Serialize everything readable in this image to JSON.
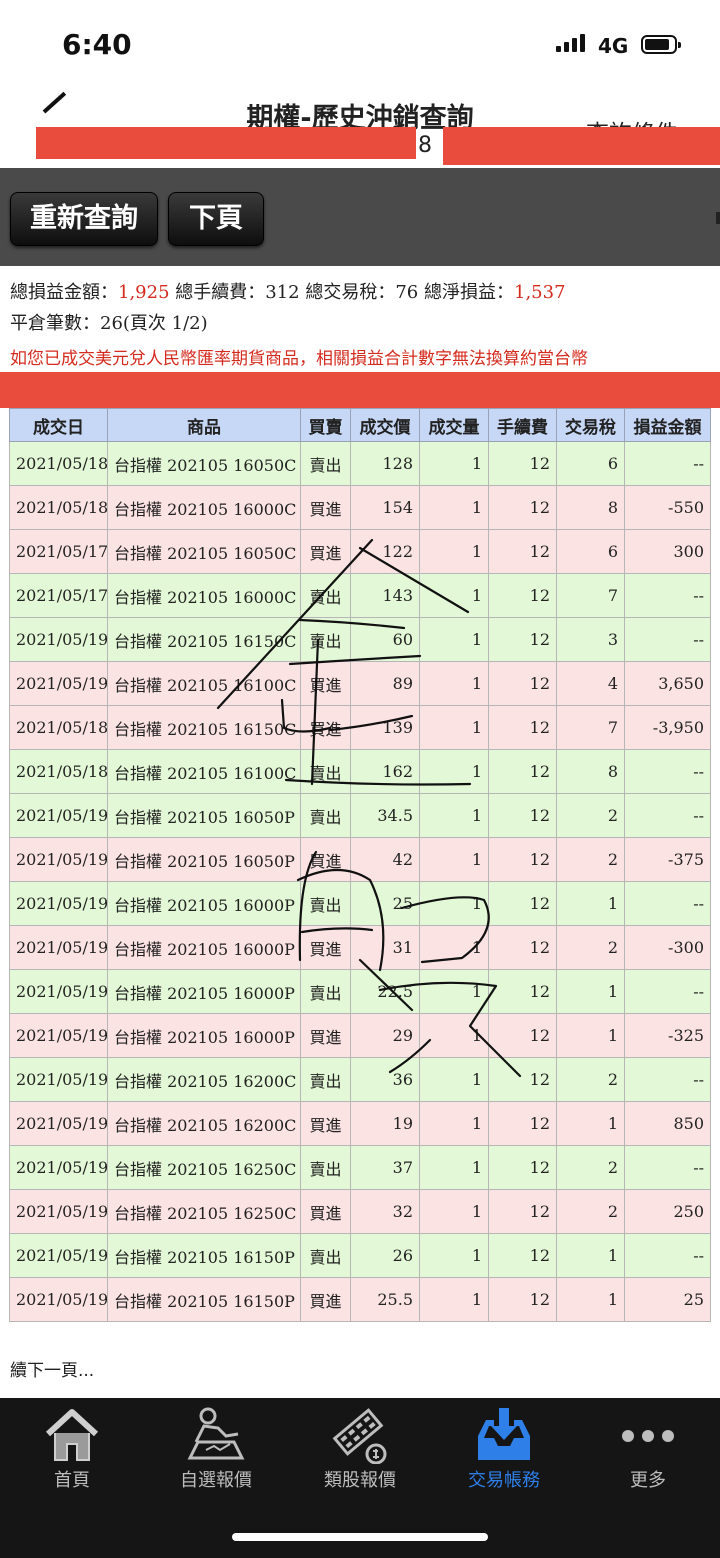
{
  "status_bar": {
    "time": "6:40",
    "carrier": "4G"
  },
  "nav": {
    "title": "期權-歷史沖銷查詢",
    "query_link": "查詢條件",
    "account_fragment": "8"
  },
  "toolbar": {
    "requery_label": "重新查詢",
    "next_page_label": "下頁"
  },
  "summary": {
    "total_pl_label": "總損益金額：",
    "total_pl": "1,925",
    "total_fee_label": "總手續費：",
    "total_fee": "312",
    "total_tax_label": "總交易稅：",
    "total_tax": "76",
    "net_pl_label": "總淨損益：",
    "net_pl": "1,537",
    "count_label": "平倉筆數：",
    "count": "26",
    "page_info": "(頁次 1/2)",
    "notice": "如您已成交美元兌人民幣匯率期貨商品，相關損益合計數字無法換算約當台幣"
  },
  "table": {
    "headers": [
      "成交日",
      "商品",
      "買賣",
      "成交價",
      "成交量",
      "手續費",
      "交易稅",
      "損益金額"
    ],
    "rows": [
      {
        "date": "2021/05/18",
        "product": "台指權 202105 16050C",
        "side": "賣出",
        "price": "128",
        "qty": "1",
        "fee": "12",
        "tax": "6",
        "pl": "--"
      },
      {
        "date": "2021/05/18",
        "product": "台指權 202105 16000C",
        "side": "買進",
        "price": "154",
        "qty": "1",
        "fee": "12",
        "tax": "8",
        "pl": "-550"
      },
      {
        "date": "2021/05/17",
        "product": "台指權 202105 16050C",
        "side": "買進",
        "price": "122",
        "qty": "1",
        "fee": "12",
        "tax": "6",
        "pl": "300"
      },
      {
        "date": "2021/05/17",
        "product": "台指權 202105 16000C",
        "side": "賣出",
        "price": "143",
        "qty": "1",
        "fee": "12",
        "tax": "7",
        "pl": "--"
      },
      {
        "date": "2021/05/19",
        "product": "台指權 202105 16150C",
        "side": "賣出",
        "price": "60",
        "qty": "1",
        "fee": "12",
        "tax": "3",
        "pl": "--"
      },
      {
        "date": "2021/05/19",
        "product": "台指權 202105 16100C",
        "side": "買進",
        "price": "89",
        "qty": "1",
        "fee": "12",
        "tax": "4",
        "pl": "3,650"
      },
      {
        "date": "2021/05/18",
        "product": "台指權 202105 16150C",
        "side": "買進",
        "price": "139",
        "qty": "1",
        "fee": "12",
        "tax": "7",
        "pl": "-3,950"
      },
      {
        "date": "2021/05/18",
        "product": "台指權 202105 16100C",
        "side": "賣出",
        "price": "162",
        "qty": "1",
        "fee": "12",
        "tax": "8",
        "pl": "--"
      },
      {
        "date": "2021/05/19",
        "product": "台指權 202105 16050P",
        "side": "賣出",
        "price": "34.5",
        "qty": "1",
        "fee": "12",
        "tax": "2",
        "pl": "--"
      },
      {
        "date": "2021/05/19",
        "product": "台指權 202105 16050P",
        "side": "買進",
        "price": "42",
        "qty": "1",
        "fee": "12",
        "tax": "2",
        "pl": "-375"
      },
      {
        "date": "2021/05/19",
        "product": "台指權 202105 16000P",
        "side": "賣出",
        "price": "25",
        "qty": "1",
        "fee": "12",
        "tax": "1",
        "pl": "--"
      },
      {
        "date": "2021/05/19",
        "product": "台指權 202105 16000P",
        "side": "買進",
        "price": "31",
        "qty": "1",
        "fee": "12",
        "tax": "2",
        "pl": "-300"
      },
      {
        "date": "2021/05/19",
        "product": "台指權 202105 16000P",
        "side": "賣出",
        "price": "22.5",
        "qty": "1",
        "fee": "12",
        "tax": "1",
        "pl": "--"
      },
      {
        "date": "2021/05/19",
        "product": "台指權 202105 16000P",
        "side": "買進",
        "price": "29",
        "qty": "1",
        "fee": "12",
        "tax": "1",
        "pl": "-325"
      },
      {
        "date": "2021/05/19",
        "product": "台指權 202105 16200C",
        "side": "賣出",
        "price": "36",
        "qty": "1",
        "fee": "12",
        "tax": "2",
        "pl": "--"
      },
      {
        "date": "2021/05/19",
        "product": "台指權 202105 16200C",
        "side": "買進",
        "price": "19",
        "qty": "1",
        "fee": "12",
        "tax": "1",
        "pl": "850"
      },
      {
        "date": "2021/05/19",
        "product": "台指權 202105 16250C",
        "side": "賣出",
        "price": "37",
        "qty": "1",
        "fee": "12",
        "tax": "2",
        "pl": "--"
      },
      {
        "date": "2021/05/19",
        "product": "台指權 202105 16250C",
        "side": "買進",
        "price": "32",
        "qty": "1",
        "fee": "12",
        "tax": "2",
        "pl": "250"
      },
      {
        "date": "2021/05/19",
        "product": "台指權 202105 16150P",
        "side": "賣出",
        "price": "26",
        "qty": "1",
        "fee": "12",
        "tax": "1",
        "pl": "--"
      },
      {
        "date": "2021/05/19",
        "product": "台指權 202105 16150P",
        "side": "買進",
        "price": "25.5",
        "qty": "1",
        "fee": "12",
        "tax": "1",
        "pl": "25"
      }
    ]
  },
  "continue_text": "續下一頁...",
  "tabs": [
    {
      "label": "首頁",
      "icon": "home-icon",
      "active": false
    },
    {
      "label": "自選報價",
      "icon": "user-chart-icon",
      "active": false
    },
    {
      "label": "類股報價",
      "icon": "film-coin-icon",
      "active": false
    },
    {
      "label": "交易帳務",
      "icon": "inbox-download-icon",
      "active": true
    },
    {
      "label": "更多",
      "icon": "more-dots-icon",
      "active": false
    }
  ],
  "colors": {
    "sell": "#1f8a1f",
    "buy": "#d42b1e",
    "header_bg": "#c6d8f6",
    "active_tab": "#2e7fe8",
    "redaction": "#e94b3c"
  }
}
